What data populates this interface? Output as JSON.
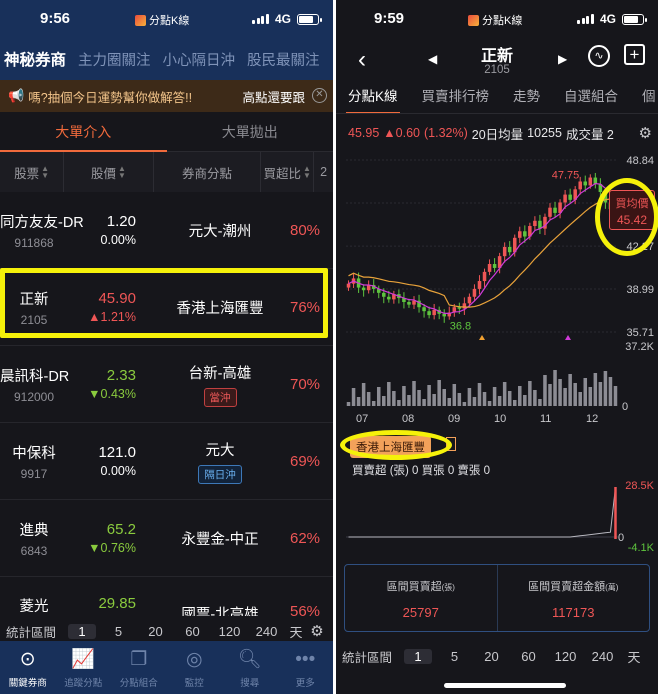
{
  "left": {
    "status": {
      "time": "9:56",
      "app": "分點K線",
      "network": "4G"
    },
    "topnav": [
      "神秘券商",
      "主力圈關注",
      "小心隔日沖",
      "股民最關注"
    ],
    "banner": {
      "text": "嗎?抽個今日運勢幫你做解答!!",
      "right": "高點還要跟"
    },
    "subtabs": [
      "大單介入",
      "大單拋出"
    ],
    "headers": {
      "stock": "股票",
      "price": "股價",
      "broker": "券商分點",
      "ratio": "買超比",
      "extra": "2"
    },
    "rows": [
      {
        "name": "同方友友-DR",
        "code": "911868",
        "price": "1.20",
        "change": "0.00%",
        "broker": "元大-潮州",
        "tag": "",
        "ratio": "80%"
      },
      {
        "name": "正新",
        "code": "2105",
        "price": "45.90",
        "change": "▲1.21%",
        "broker": "香港上海匯豐",
        "tag": "",
        "ratio": "76%"
      },
      {
        "name": "晨訊科-DR",
        "code": "912000",
        "price": "2.33",
        "change": "▼0.43%",
        "broker": "台新-高雄",
        "tag": "當沖",
        "ratio": "70%"
      },
      {
        "name": "中保科",
        "code": "9917",
        "price": "121.0",
        "change": "0.00%",
        "broker": "元大",
        "tag": "隔日沖",
        "ratio": "69%"
      },
      {
        "name": "進典",
        "code": "6843",
        "price": "65.2",
        "change": "▼0.76%",
        "broker": "永豐金-中正",
        "tag": "",
        "ratio": "62%"
      },
      {
        "name": "菱光",
        "code": "",
        "price": "29.85",
        "change": "",
        "broker": "國票-北高雄",
        "tag": "",
        "ratio": "56%"
      }
    ],
    "interval": {
      "label": "統計區間",
      "options": [
        "1",
        "5",
        "20",
        "60",
        "120",
        "240"
      ],
      "unit": "天"
    },
    "tabs": [
      "關鍵券商",
      "追蹤分點",
      "分點組合",
      "監控",
      "搜尋",
      "更多"
    ]
  },
  "right": {
    "status": {
      "time": "9:59",
      "app": "分點K線",
      "network": "4G"
    },
    "title": "正新",
    "code": "2105",
    "tabs": [
      "分點K線",
      "買賣排行榜",
      "走勢",
      "自選組合",
      "個"
    ],
    "quote": {
      "price": "45.95",
      "change": "▲0.60",
      "pct": "(1.32%)",
      "ma_label": "20日均量",
      "ma_value": "10255",
      "vol_label": "成交量 2"
    },
    "avg_label": "買均價",
    "avg_value": "45.42",
    "broker_tag": "香港上海匯豐",
    "stats": "買賣超 (張) 0 買張 0 賣張 0",
    "summary": [
      {
        "label": "區間買賣超",
        "unit": "(張)",
        "value": "25797"
      },
      {
        "label": "區間買賣超金額",
        "unit": "(萬)",
        "value": "117173"
      }
    ],
    "interval": {
      "label": "統計區間",
      "options": [
        "1",
        "5",
        "20",
        "60",
        "120",
        "240",
        "天"
      ]
    }
  },
  "chart_data": [
    {
      "type": "candlestick",
      "y_ticks": [
        "48.84",
        "45.56",
        "42.27",
        "38.99",
        "35.71"
      ],
      "ylim": [
        35.71,
        48.84
      ],
      "x_ticks": [
        "07",
        "08",
        "09",
        "10",
        "11",
        "12"
      ],
      "annotations": [
        "47.75",
        "36.8"
      ],
      "close": [
        39.4,
        39.8,
        39.1,
        38.9,
        39.3,
        39.0,
        38.7,
        38.4,
        38.2,
        38.6,
        38.3,
        38.0,
        37.8,
        38.1,
        37.6,
        37.3,
        37.0,
        37.4,
        37.1,
        36.9,
        37.2,
        37.6,
        37.5,
        37.9,
        38.4,
        39.0,
        39.6,
        40.3,
        40.9,
        40.6,
        41.5,
        42.2,
        41.8,
        42.9,
        43.4,
        43.0,
        43.8,
        44.2,
        43.6,
        44.5,
        45.2,
        44.8,
        45.6,
        46.2,
        45.8,
        46.6,
        47.2,
        46.9,
        47.5,
        47.0,
        46.4,
        45.6,
        45.1,
        45.9
      ]
    },
    {
      "type": "bar",
      "title": "volume",
      "y_ticks": [
        "37.2K",
        "0"
      ],
      "ylim": [
        0,
        37200
      ]
    },
    {
      "type": "line",
      "title": "net buy",
      "y_ticks": [
        "28.5K",
        "0",
        "-4.1K"
      ],
      "ylim": [
        -4100,
        28500
      ]
    }
  ]
}
